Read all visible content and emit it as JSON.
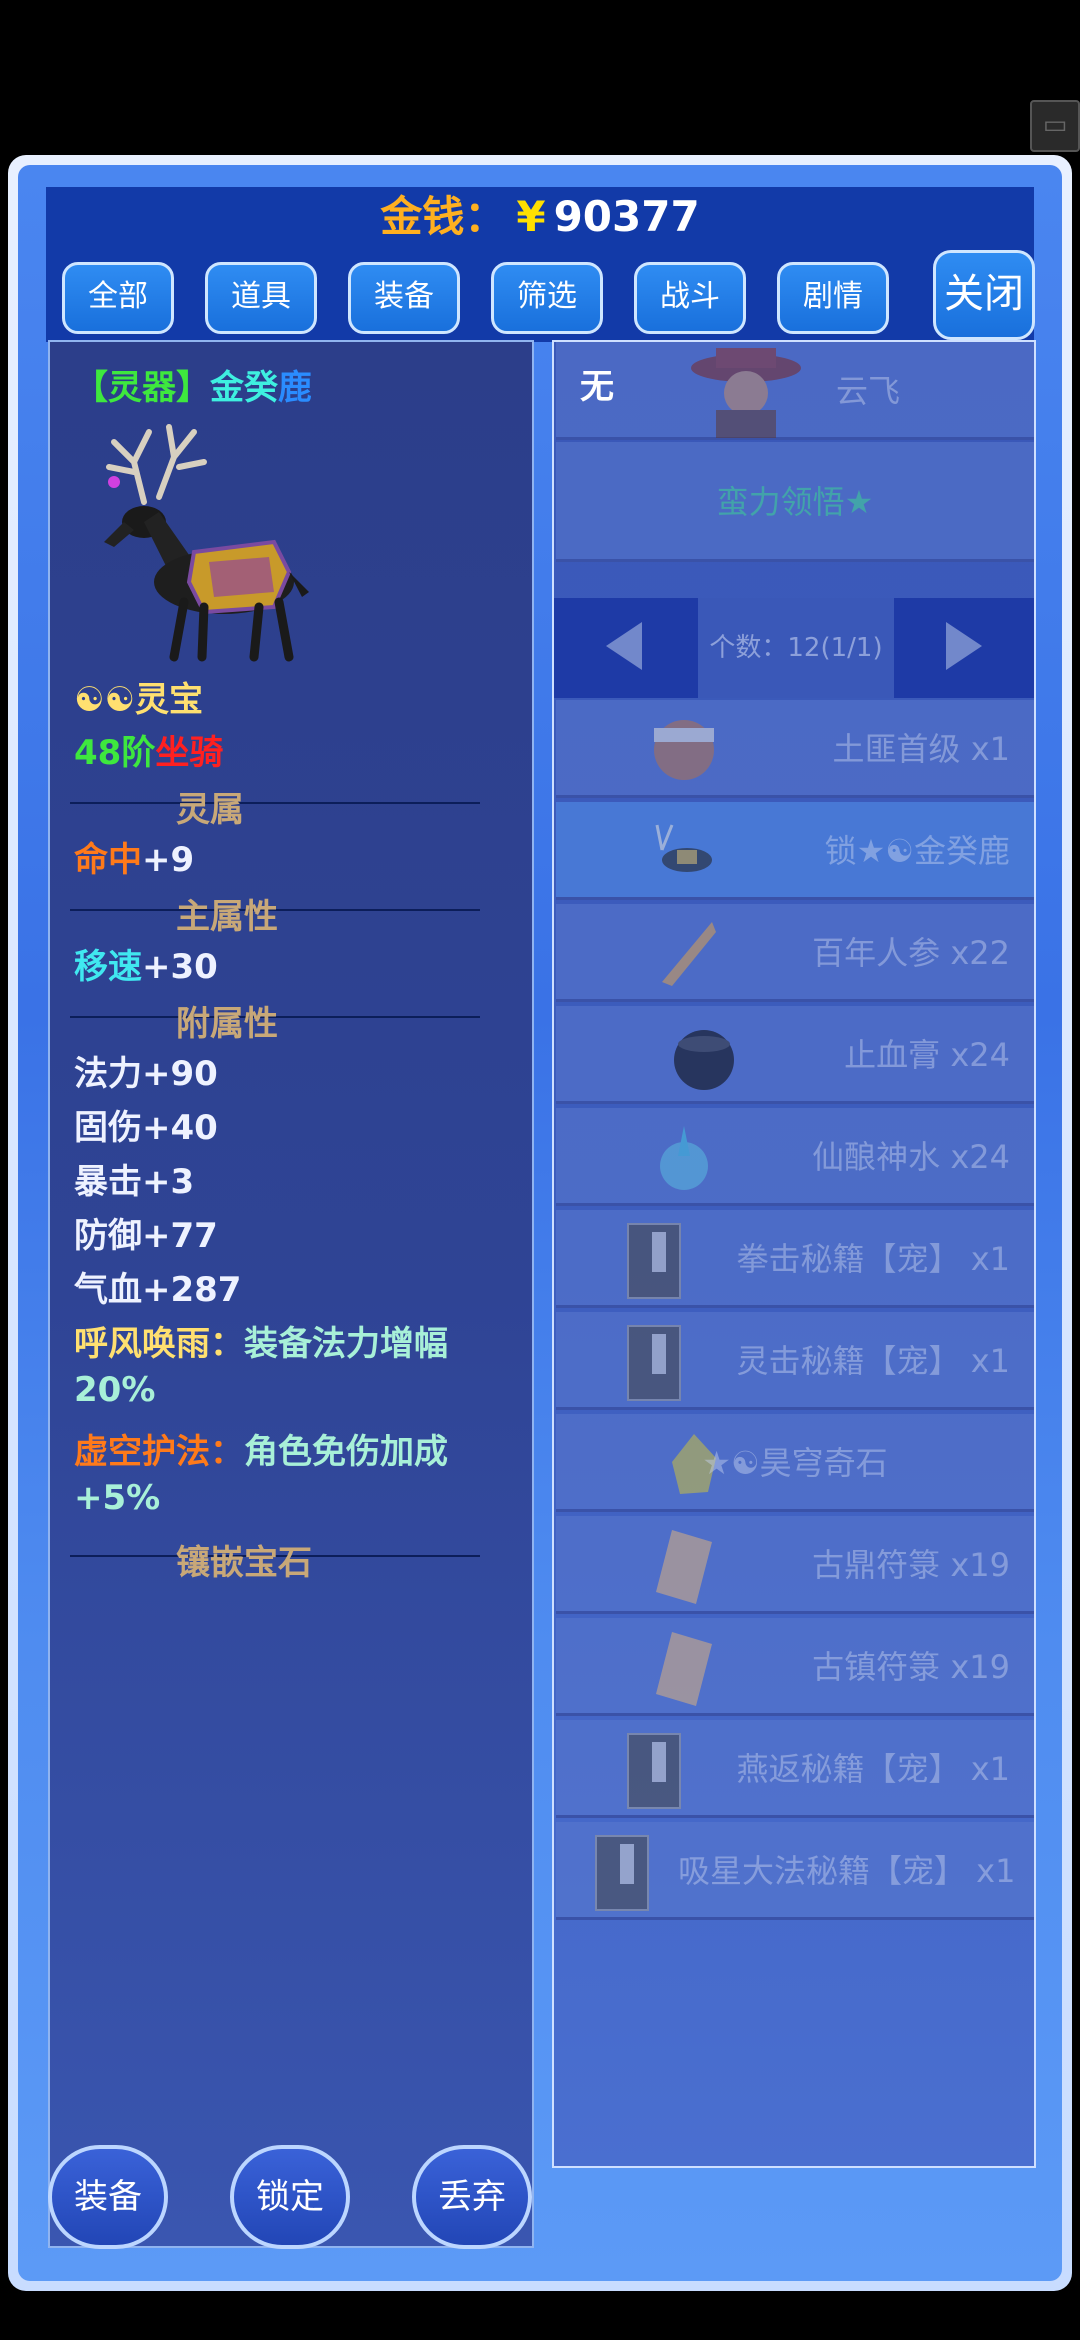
{
  "gold": {
    "label": "金钱：",
    "yen": "¥",
    "value": "90377"
  },
  "tabs": [
    "全部",
    "道具",
    "装备",
    "筛选",
    "战斗",
    "剧情"
  ],
  "close_label": "关闭",
  "detail": {
    "name_bracket": "【灵器】",
    "name_part1": "金癸",
    "name_part2": "鹿",
    "yin_yang": "☯☯",
    "treasure": "灵宝",
    "level": "48阶",
    "mount": "坐骑",
    "sec_spirit": "灵属",
    "hit_label": "命中",
    "hit_value": "+9",
    "sec_main": "主属性",
    "speed_label": "移速",
    "speed_value": "+30",
    "sec_extra": "附属性",
    "stats": [
      "法力+90",
      "固伤+40",
      "暴击+3",
      "防御+77",
      "气血+287"
    ],
    "skill1_name": "呼风唤雨：",
    "skill1_desc": "装备法力增幅",
    "skill1_desc2": "20%",
    "skill2_name": "虚空护法：",
    "skill2_desc": "角色免伤加成",
    "skill2_desc2": "+5%",
    "sec_gem": "镶嵌宝石"
  },
  "actions": {
    "equip": "装备",
    "lock": "锁定",
    "drop": "丢弃"
  },
  "colors": {
    "green": "#3ee83e",
    "red": "#ff2020",
    "orange": "#ff7a1a",
    "cyan": "#40e8f0",
    "yellow": "#ffe070",
    "gold": "#ffb020"
  },
  "list": {
    "none_label": "无",
    "character": "云飞",
    "category": "蛮力领悟★",
    "pager_text": "个数：12(1/1)",
    "items": [
      "土匪首级 x1",
      "锁★☯金癸鹿",
      "百年人参 x22",
      "止血膏 x24",
      "仙酿神水 x24",
      "拳击秘籍【宠】 x1",
      "灵击秘籍【宠】 x1",
      "★☯昊穹奇石",
      "古鼎符箓 x19",
      "古镇符箓 x19",
      "燕返秘籍【宠】 x1",
      "吸星大法秘籍【宠】 x1"
    ]
  }
}
